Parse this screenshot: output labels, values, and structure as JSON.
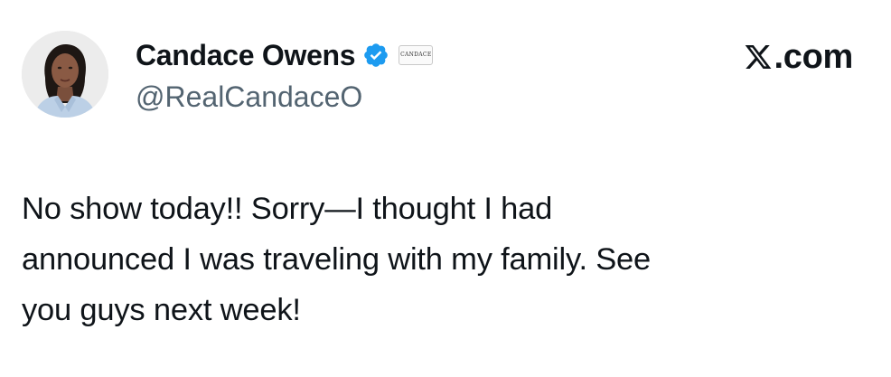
{
  "user": {
    "display_name": "Candace Owens",
    "handle": "@RealCandaceO",
    "verified_icon": "verified-badge-icon",
    "affiliate_badge_text": "CANDACE",
    "avatar_icon": "profile-photo"
  },
  "source": {
    "logo_icon": "x-logo-icon",
    "domain_suffix": ".com"
  },
  "tweet": {
    "text": "No show today!! Sorry—I thought I had\nannounced I was traveling with my family. See\nyou guys next week!"
  },
  "colors": {
    "text": "#0f1419",
    "secondary_text": "#536471",
    "verified_blue": "#1d9bf0",
    "background": "#ffffff"
  }
}
